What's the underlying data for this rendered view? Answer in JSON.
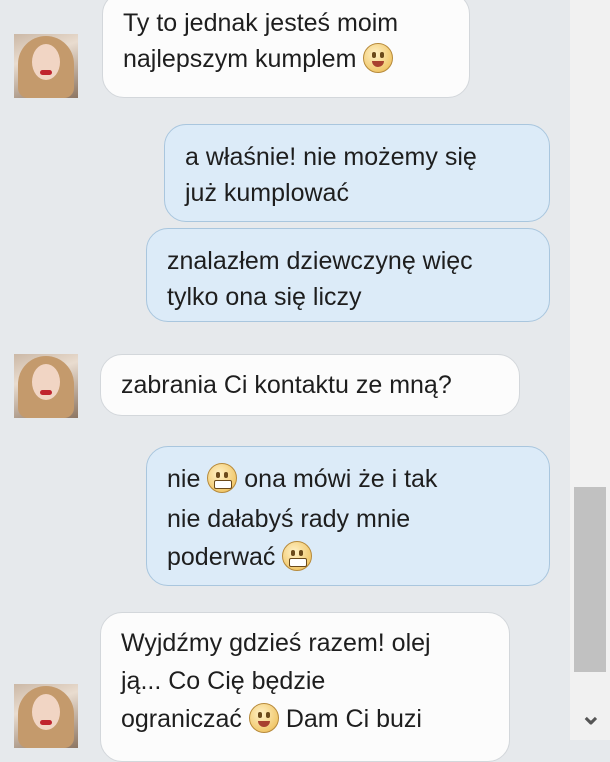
{
  "chat": {
    "messages": [
      {
        "from": "contact",
        "lines": [
          "Ty to jednak jesteś moim",
          "najlepszym kumplem"
        ]
      },
      {
        "from": "me",
        "lines": [
          "a właśnie! nie możemy się",
          "już kumplować"
        ]
      },
      {
        "from": "me",
        "lines": [
          "znalazłem dziewczynę więc",
          "tylko ona się liczy"
        ]
      },
      {
        "from": "contact",
        "lines": [
          "zabrania Ci kontaktu ze mną?"
        ]
      },
      {
        "from": "me",
        "lines": [
          "nie",
          "ona mówi że i tak",
          "nie dałabyś rady mnie",
          "poderwać"
        ]
      },
      {
        "from": "contact",
        "lines": [
          "Wyjdźmy gdzieś razem! olej",
          "ją... Co Cię będzie",
          "ograniczać",
          "Dam Ci buzi"
        ]
      }
    ]
  },
  "colors": {
    "background": "#e6e9ec",
    "incoming_bubble": "#fcfcfc",
    "outgoing_bubble": "#dcebf8",
    "outgoing_border": "#a9c6de"
  },
  "icons": {
    "avatar": "contact-avatar-photo",
    "kiss_emoji": "kiss-face-emoticon",
    "grin_emoji": "grin-face-emoticon",
    "scroll_down": "chevron-down-icon"
  }
}
